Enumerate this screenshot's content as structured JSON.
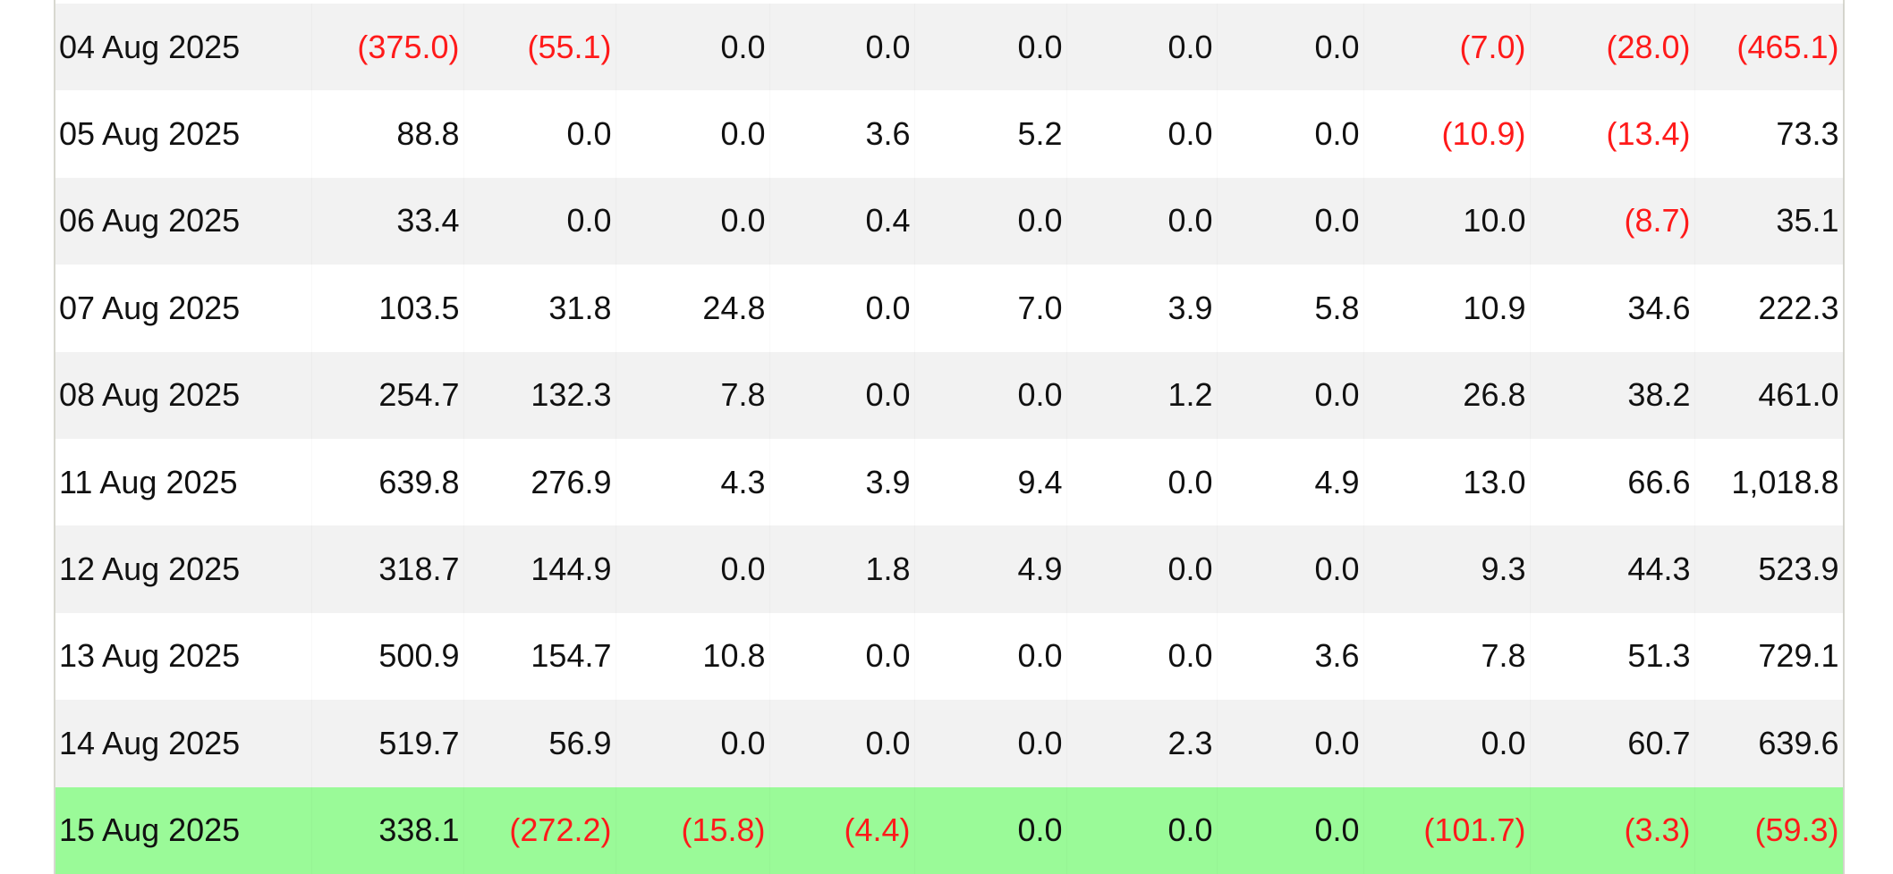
{
  "table": {
    "rows": [
      {
        "date": "04 Aug 2025",
        "values": [
          "(375.0)",
          "(55.1)",
          "0.0",
          "0.0",
          "0.0",
          "0.0",
          "0.0",
          "(7.0)",
          "(28.0)",
          "(465.1)"
        ]
      },
      {
        "date": "05 Aug 2025",
        "values": [
          "88.8",
          "0.0",
          "0.0",
          "3.6",
          "5.2",
          "0.0",
          "0.0",
          "(10.9)",
          "(13.4)",
          "73.3"
        ]
      },
      {
        "date": "06 Aug 2025",
        "values": [
          "33.4",
          "0.0",
          "0.0",
          "0.4",
          "0.0",
          "0.0",
          "0.0",
          "10.0",
          "(8.7)",
          "35.1"
        ]
      },
      {
        "date": "07 Aug 2025",
        "values": [
          "103.5",
          "31.8",
          "24.8",
          "0.0",
          "7.0",
          "3.9",
          "5.8",
          "10.9",
          "34.6",
          "222.3"
        ]
      },
      {
        "date": "08 Aug 2025",
        "values": [
          "254.7",
          "132.3",
          "7.8",
          "0.0",
          "0.0",
          "1.2",
          "0.0",
          "26.8",
          "38.2",
          "461.0"
        ]
      },
      {
        "date": "11 Aug 2025",
        "values": [
          "639.8",
          "276.9",
          "4.3",
          "3.9",
          "9.4",
          "0.0",
          "4.9",
          "13.0",
          "66.6",
          "1,018.8"
        ]
      },
      {
        "date": "12 Aug 2025",
        "values": [
          "318.7",
          "144.9",
          "0.0",
          "1.8",
          "4.9",
          "0.0",
          "0.0",
          "9.3",
          "44.3",
          "523.9"
        ]
      },
      {
        "date": "13 Aug 2025",
        "values": [
          "500.9",
          "154.7",
          "10.8",
          "0.0",
          "0.0",
          "0.0",
          "3.6",
          "7.8",
          "51.3",
          "729.1"
        ]
      },
      {
        "date": "14 Aug 2025",
        "values": [
          "519.7",
          "56.9",
          "0.0",
          "0.0",
          "0.0",
          "2.3",
          "0.0",
          "0.0",
          "60.7",
          "639.6"
        ]
      },
      {
        "date": "15 Aug 2025",
        "values": [
          "338.1",
          "(272.2)",
          "(15.8)",
          "(4.4)",
          "0.0",
          "0.0",
          "0.0",
          "(101.7)",
          "(3.3)",
          "(59.3)"
        ],
        "highlighted": true
      }
    ]
  },
  "colors": {
    "negative": "#ff1a1a",
    "row_alt": "#f2f2f2",
    "row_plain": "#ffffff",
    "highlight": "#9afa98"
  }
}
